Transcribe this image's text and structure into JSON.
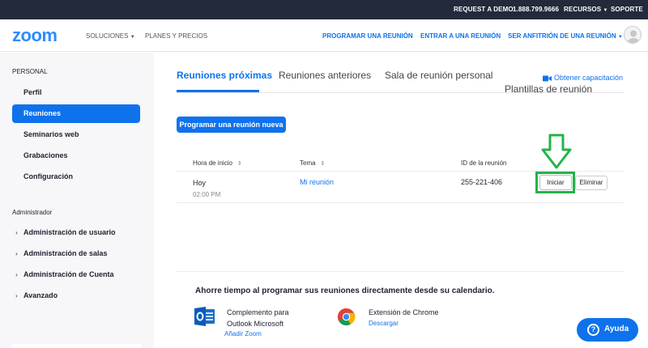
{
  "topbar": {
    "request_demo": "REQUEST A DEMO",
    "phone": "1.888.799.9666",
    "resources": "RECURSOS",
    "support": "SOPORTE"
  },
  "header": {
    "logo": "zoom",
    "solutions": "SOLUCIONES",
    "plans": "PLANES Y PRECIOS",
    "schedule": "PROGRAMAR UNA REUNIÓN",
    "join": "ENTRAR A UNA REUNIÓN",
    "host": "SER ANFITRIÓN DE UNA REUNIÓN"
  },
  "sidebar": {
    "personal_label": "PERSONAL",
    "personal_items": [
      {
        "label": "Perfil"
      },
      {
        "label": "Reuniones",
        "active": true
      },
      {
        "label": "Seminarios web"
      },
      {
        "label": "Grabaciones"
      },
      {
        "label": "Configuración"
      }
    ],
    "admin_label": "Administrador",
    "admin_items": [
      {
        "label": "Administración de usuario"
      },
      {
        "label": "Administración de salas"
      },
      {
        "label": "Administración de Cuenta"
      },
      {
        "label": "Avanzado"
      }
    ]
  },
  "tabs": [
    {
      "label": "Reuniones próximas",
      "active": true
    },
    {
      "label": "Reuniones anteriores"
    },
    {
      "label": "Sala de reunión personal"
    },
    {
      "label": "Plantillas de reunión"
    }
  ],
  "training_link": "Obtener capacitación",
  "schedule_new_button": "Programar una reunión nueva",
  "table": {
    "headers": {
      "start_time": "Hora de inicio",
      "topic": "Tema",
      "meeting_id": "ID de la reunión"
    },
    "rows": [
      {
        "day": "Hoy",
        "time": "02:00 PM",
        "topic": "Mi reunión",
        "id": "255-221-406",
        "start_label": "Iniciar",
        "delete_label": "Eliminar"
      }
    ]
  },
  "promo": {
    "title": "Ahorre tiempo al programar sus reuniones directamente desde su calendario.",
    "outlook_name_line1": "Complemento para",
    "outlook_name_line2": "Outlook Microsoft",
    "outlook_link": "Añadir Zoom",
    "chrome_name": "Extensión de Chrome",
    "chrome_link": "Descargar"
  },
  "help_button": "Ayuda",
  "colors": {
    "brand_blue": "#0e72ed",
    "topbar_bg": "#232a3b",
    "highlight_green": "#22b44a"
  }
}
